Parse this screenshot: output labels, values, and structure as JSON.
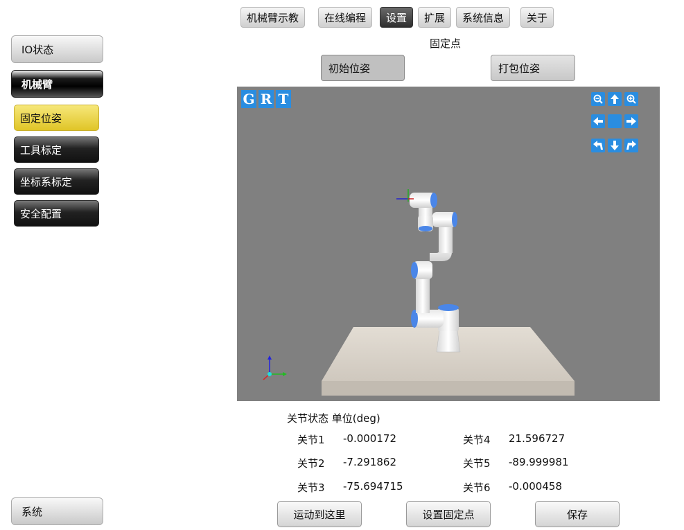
{
  "tabs": [
    {
      "label": "机械臂示教",
      "active": false
    },
    {
      "label": "在线编程",
      "active": false
    },
    {
      "label": "设置",
      "active": true
    },
    {
      "label": "扩展",
      "active": false
    },
    {
      "label": "系统信息",
      "active": false
    },
    {
      "label": "关于",
      "active": false
    }
  ],
  "sidebar": {
    "io_status": "IO状态",
    "robot_arm": "机械臂",
    "sub_items": [
      "固定位姿",
      "工具标定",
      "坐标系标定",
      "安全配置"
    ],
    "system": "系统"
  },
  "page": {
    "section_title": "固定点",
    "initial_pose": "初始位姿",
    "pack_pose": "打包位姿"
  },
  "viewport": {
    "view_buttons": [
      "G",
      "R",
      "T"
    ],
    "nav_icons": [
      "zoom-out-icon",
      "arrow-up-icon",
      "zoom-in-icon",
      "arrow-left-icon",
      "center-icon",
      "arrow-right-icon",
      "rotate-left-icon",
      "arrow-down-icon",
      "rotate-right-icon"
    ],
    "colors": {
      "background": "#808080",
      "button": "#2a8de0",
      "table": "#d8d2ca",
      "joint_cap": "#4a86e8"
    }
  },
  "joints": {
    "header": "关节状态 单位(deg)",
    "list": [
      {
        "label": "关节1",
        "value": "-0.000172"
      },
      {
        "label": "关节2",
        "value": "-7.291862"
      },
      {
        "label": "关节3",
        "value": "-75.694715"
      },
      {
        "label": "关节4",
        "value": "21.596727"
      },
      {
        "label": "关节5",
        "value": "-89.999981"
      },
      {
        "label": "关节6",
        "value": "-0.000458"
      }
    ]
  },
  "actions": {
    "move_here": "运动到这里",
    "set_fixed_point": "设置固定点",
    "save": "保存"
  }
}
